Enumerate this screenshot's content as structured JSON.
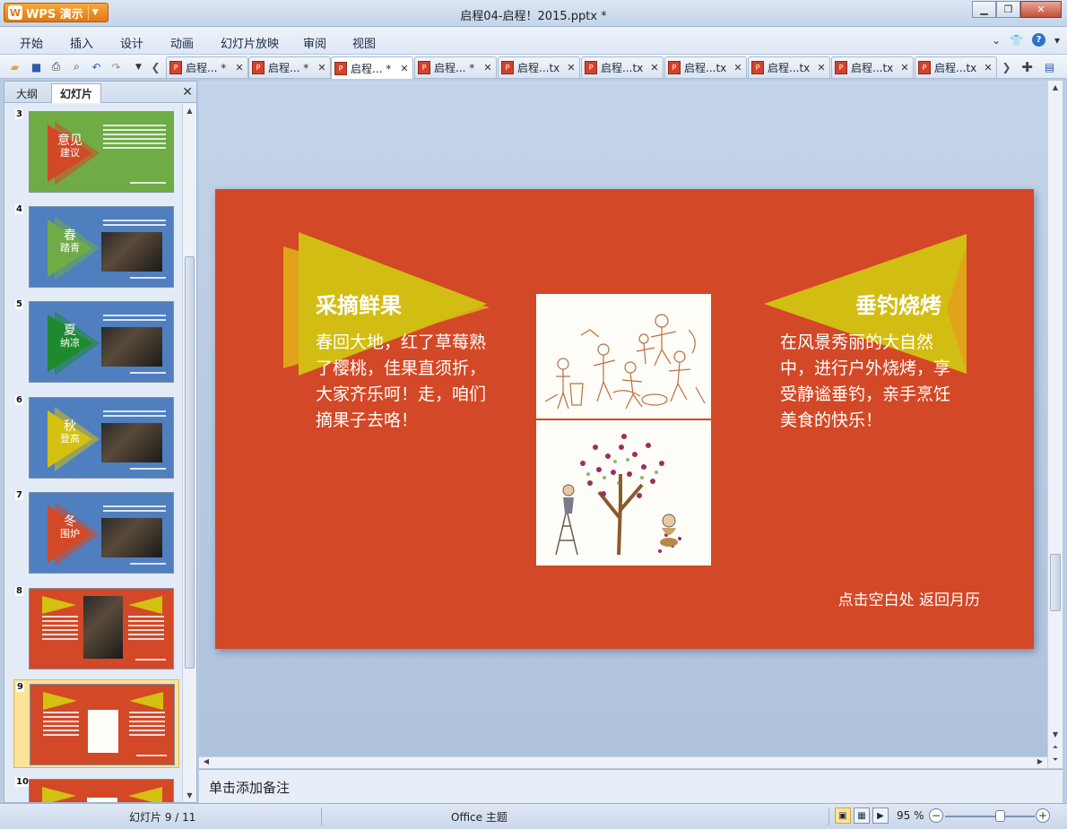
{
  "app": {
    "name": "WPS 演示",
    "window_title": "启程04-启程！2015.pptx *"
  },
  "menu": [
    "开始",
    "插入",
    "设计",
    "动画",
    "幻灯片放映",
    "审阅",
    "视图"
  ],
  "tabs": [
    {
      "label": "启程...",
      "mark": "*"
    },
    {
      "label": "启程...",
      "mark": "*"
    },
    {
      "label": "启程...",
      "mark": "*"
    },
    {
      "label": "启程...",
      "mark": "*"
    },
    {
      "label": "启程...tx",
      "mark": ""
    },
    {
      "label": "启程...tx",
      "mark": ""
    },
    {
      "label": "启程...tx",
      "mark": ""
    },
    {
      "label": "启程...tx",
      "mark": ""
    },
    {
      "label": "启程...tx",
      "mark": ""
    },
    {
      "label": "启程...tx",
      "mark": ""
    }
  ],
  "active_tab_index": 2,
  "left_panel": {
    "tabs": [
      "大纲",
      "幻灯片"
    ],
    "active_tab": "幻灯片",
    "thumbnails": [
      {
        "number": "3",
        "bg": "#6fac46",
        "tri": "#d34826",
        "title": "意见",
        "subtitle": "建议"
      },
      {
        "number": "4",
        "bg": "#4f7fbf",
        "tri": "#6fac46",
        "title": "春",
        "subtitle": "踏青"
      },
      {
        "number": "5",
        "bg": "#4f7fbf",
        "tri": "#1d8a2e",
        "title": "夏",
        "subtitle": "纳凉"
      },
      {
        "number": "6",
        "bg": "#4f7fbf",
        "tri": "#d4c010",
        "title": "秋",
        "subtitle": "登高"
      },
      {
        "number": "7",
        "bg": "#4f7fbf",
        "tri": "#d34826",
        "title": "冬",
        "subtitle": "围炉"
      },
      {
        "number": "8",
        "bg": "#d34826",
        "tri": "#d4c010",
        "title": "",
        "subtitle": ""
      },
      {
        "number": "9",
        "bg": "#d34826",
        "tri": "#d4c010",
        "title": "",
        "subtitle": ""
      },
      {
        "number": "10",
        "bg": "#d34826",
        "tri": "#d4c010",
        "title": "",
        "subtitle": ""
      }
    ],
    "selected_number": "9"
  },
  "slide": {
    "bg_color": "#d34826",
    "accent_color": "#d2bd12",
    "left_heading": "采摘鲜果",
    "left_body": "春回大地，红了草莓熟了樱桃，佳果直须折，大家齐乐呵！走，咱们摘果子去咯！",
    "right_heading": "垂钓烧烤",
    "right_body": "在风景秀丽的大自然中，进行户外烧烤，享受静谧垂钓，亲手烹饪美食的快乐！",
    "return_text": "点击空白处 返回月历"
  },
  "notes_placeholder": "单击添加备注",
  "status": {
    "slide_indicator": "幻灯片 9 / 11",
    "theme": "Office 主题",
    "zoom_label": "95 %",
    "zoom_percent": 95
  }
}
